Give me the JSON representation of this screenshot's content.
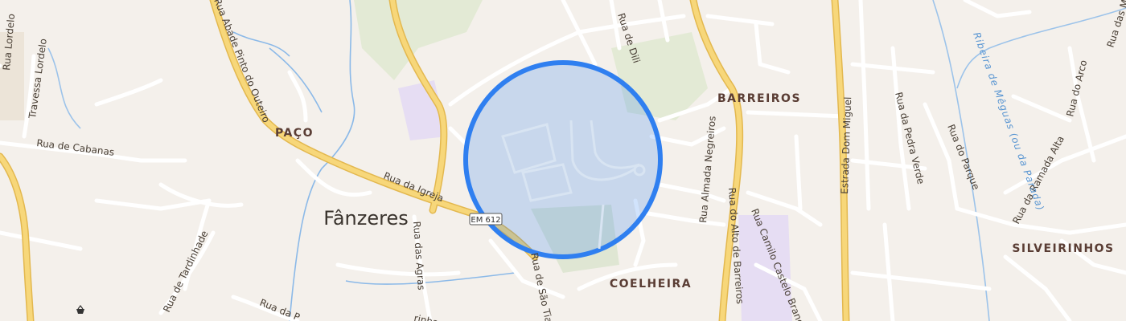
{
  "map": {
    "towns": [
      {
        "name": "Fânzeres"
      }
    ],
    "places": [
      {
        "name": "PAÇO"
      },
      {
        "name": "BARREIROS"
      },
      {
        "name": "COELHEIRA"
      },
      {
        "name": "SILVEIRINHOS"
      }
    ],
    "road_shield": {
      "ref": "EM 612"
    },
    "roads": [
      {
        "name": "Rua Lordelo"
      },
      {
        "name": "Travessa Lordelo"
      },
      {
        "name": "Rua Abade Pinto do Outeiro"
      },
      {
        "name": "Rua de Cabanas"
      },
      {
        "name": "Rua da Igreja"
      },
      {
        "name": "Rua das Agras"
      },
      {
        "name": "Rua de Tardinhade"
      },
      {
        "name": "Rua da P"
      },
      {
        "name": "Rua de Dili"
      },
      {
        "name": "Rua Almada Negreiros"
      },
      {
        "name": "Rua do Alto de Barreiros"
      },
      {
        "name": "Rua Camilo Castelo Branco"
      },
      {
        "name": "Estrada Dom Miguel"
      },
      {
        "name": "Rua da Pedra Verde"
      },
      {
        "name": "Rua do Parque"
      },
      {
        "name": "Rua da Ramada Alta"
      },
      {
        "name": "Rua do Arco"
      },
      {
        "name": "Rua de São Tiag"
      },
      {
        "name": "rinha"
      },
      {
        "name": "Rua das Mili"
      }
    ],
    "water": [
      {
        "name": "Ribeira de Mêguas (ou da Parada)"
      }
    ],
    "highlight": {
      "shape": "circle",
      "color": "#2f7ff0"
    },
    "colors": {
      "background": "#f4f0eb",
      "major_road": "#f7d77a",
      "major_road_casing": "#e3b84f",
      "minor_road": "#ffffff",
      "water": "#8bb9e8",
      "park": "#e3ead5",
      "institution": "#e8e0f4"
    }
  }
}
